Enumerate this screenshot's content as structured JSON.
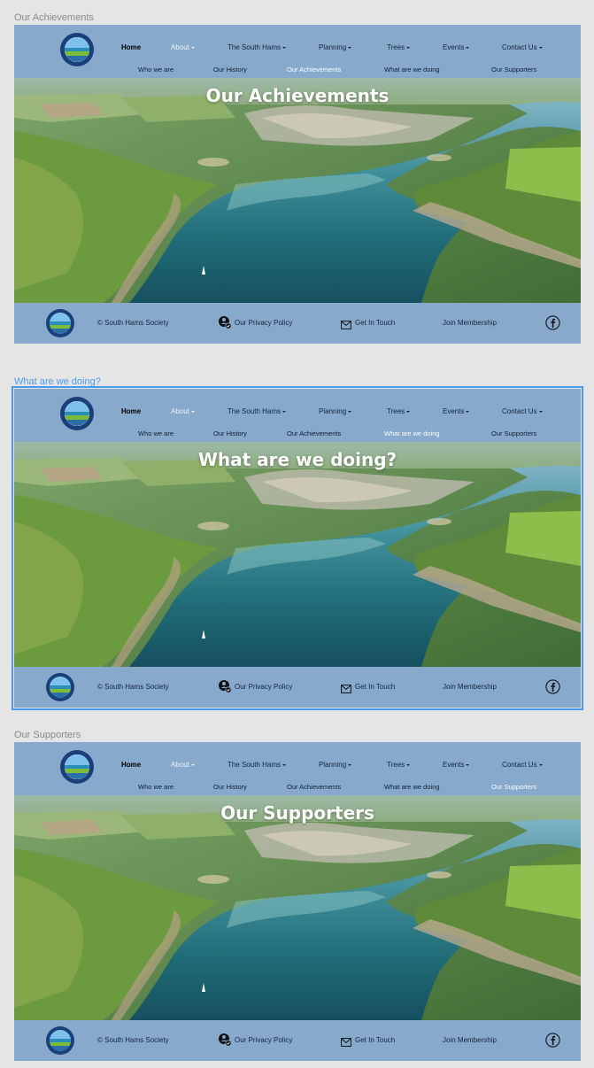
{
  "frames": [
    {
      "label": "Our Achievements",
      "hero_title": "Our Achievements",
      "active_sub": 2,
      "selected": false
    },
    {
      "label": "What are we doing?",
      "hero_title": "What are we doing?",
      "active_sub": 3,
      "selected": true
    },
    {
      "label": "Our Supporters",
      "hero_title": "Our Supporters",
      "active_sub": 4,
      "selected": false
    }
  ],
  "nav": {
    "home": "Home",
    "about": "About",
    "south_hams": "The South Hams",
    "planning": "Planning",
    "trees": "Trees",
    "events": "Events",
    "contact": "Contact Us"
  },
  "subnav": [
    "Who we are",
    "Our History",
    "Our Achievements",
    "What are we doing",
    "Our Supporters"
  ],
  "footer": {
    "copyright": "© South Hams Society",
    "privacy": "Our Privacy Policy",
    "contact": "Get In Touch",
    "membership": "Join Membership"
  },
  "colors": {
    "header_bg": "#86a9cc",
    "canvas_bg": "#e5e5e5",
    "selection": "#4a9bf0"
  },
  "icons": {
    "privacy": "privacy-shield-icon",
    "mail": "mail-icon",
    "facebook": "facebook-icon"
  }
}
